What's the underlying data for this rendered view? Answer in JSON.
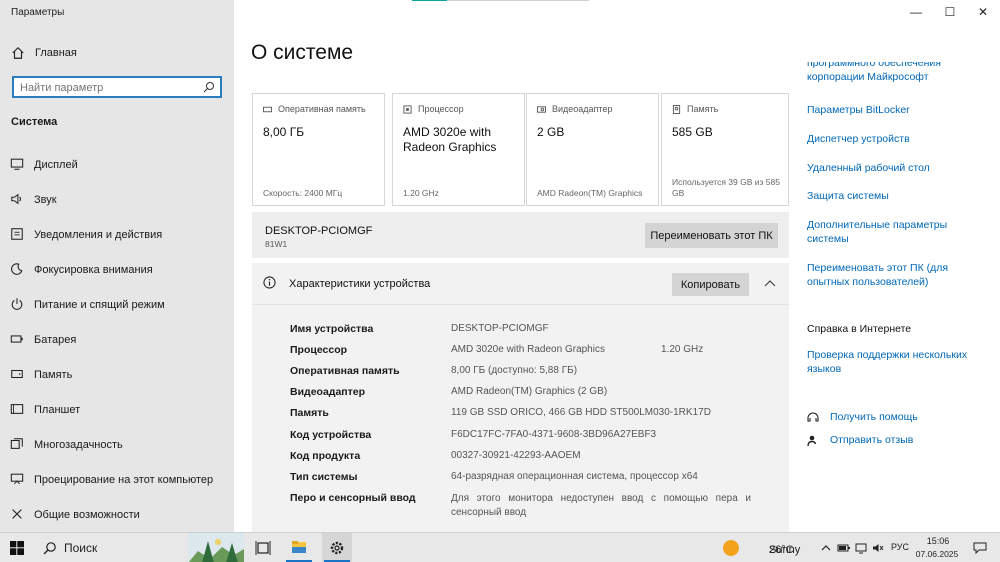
{
  "window": {
    "app_title": "Параметры",
    "controls": {
      "minimize": "—",
      "maximize": "☐",
      "close": "✕"
    }
  },
  "sidebar": {
    "home_label": "Главная",
    "search_placeholder": "Найти параметр",
    "section_title": "Система",
    "items": [
      {
        "label": "Дисплей",
        "icon": "display-icon"
      },
      {
        "label": "Звук",
        "icon": "sound-icon"
      },
      {
        "label": "Уведомления и действия",
        "icon": "notifications-icon"
      },
      {
        "label": "Фокусировка внимания",
        "icon": "focus-icon"
      },
      {
        "label": "Питание и спящий режим",
        "icon": "power-icon"
      },
      {
        "label": "Батарея",
        "icon": "battery-icon"
      },
      {
        "label": "Память",
        "icon": "storage-icon"
      },
      {
        "label": "Планшет",
        "icon": "tablet-icon"
      },
      {
        "label": "Многозадачность",
        "icon": "multitasking-icon"
      },
      {
        "label": "Проецирование на этот компьютер",
        "icon": "projecting-icon"
      },
      {
        "label": "Общие возможности",
        "icon": "shared-experiences-icon"
      }
    ]
  },
  "main": {
    "title": "О системе",
    "cards": [
      {
        "label": "Оперативная память",
        "value": "8,00 ГБ",
        "footer": "Скорость: 2400 МГц",
        "icon": "ram-icon"
      },
      {
        "label": "Процессор",
        "value": "AMD 3020e with Radeon Graphics",
        "footer": "1.20 GHz",
        "icon": "cpu-icon"
      },
      {
        "label": "Видеоадаптер",
        "value": "2 GB",
        "footer": "AMD Radeon(TM) Graphics",
        "icon": "gpu-icon"
      },
      {
        "label": "Память",
        "value": "585 GB",
        "footer": "Используется 39 GB из 585 GB",
        "icon": "disk-icon"
      }
    ],
    "pc": {
      "name": "DESKTOP-PCIOMGF",
      "model": "81W1",
      "rename_button": "Переименовать этот ПК"
    },
    "specs": {
      "title": "Характеристики устройства",
      "copy_button": "Копировать",
      "rows": [
        {
          "key": "Имя устройства",
          "value": "DESKTOP-PCIOMGF",
          "extra": ""
        },
        {
          "key": "Процессор",
          "value": "AMD 3020e with Radeon Graphics",
          "extra": "1.20 GHz"
        },
        {
          "key": "Оперативная память",
          "value": "8,00 ГБ (доступно: 5,88 ГБ)",
          "extra": ""
        },
        {
          "key": "Видеоадаптер",
          "value": "AMD Radeon(TM) Graphics (2 GB)",
          "extra": ""
        },
        {
          "key": "Память",
          "value": "119 GB SSD ORICO, 466 GB HDD ST500LM030-1RK17D",
          "extra": ""
        },
        {
          "key": "Код устройства",
          "value": "F6DC17FC-7FA0-4371-9608-3BD96A27EBF3",
          "extra": ""
        },
        {
          "key": "Код продукта",
          "value": "00327-30921-42293-AAOEM",
          "extra": ""
        },
        {
          "key": "Тип системы",
          "value": "64-разрядная операционная система, процессор x64",
          "extra": ""
        },
        {
          "key": "Перо и сенсорный ввод",
          "value": "Для этого монитора недоступен ввод с помощью пера и сенсорный ввод",
          "extra": ""
        }
      ]
    }
  },
  "right_panel": {
    "partial_link": "программного обеспечения корпорации Майкрософт",
    "links": [
      "Параметры BitLocker",
      "Диспетчер устройств",
      "Удаленный рабочий стол",
      "Защита системы",
      "Дополнительные параметры системы",
      "Переименовать этот ПК (для опытных пользователей)"
    ],
    "help_heading": "Справка в Интернете",
    "help_link": "Проверка поддержки нескольких языков",
    "support": [
      {
        "label": "Получить помощь",
        "icon": "help-icon"
      },
      {
        "label": "Отправить отзыв",
        "icon": "feedback-icon"
      }
    ]
  },
  "taskbar": {
    "search_label": "Поиск",
    "weather_temp": "26°C",
    "weather_text": "Sunny",
    "lang": "РУС",
    "time": "15:06",
    "date": "07.06.2025"
  }
}
